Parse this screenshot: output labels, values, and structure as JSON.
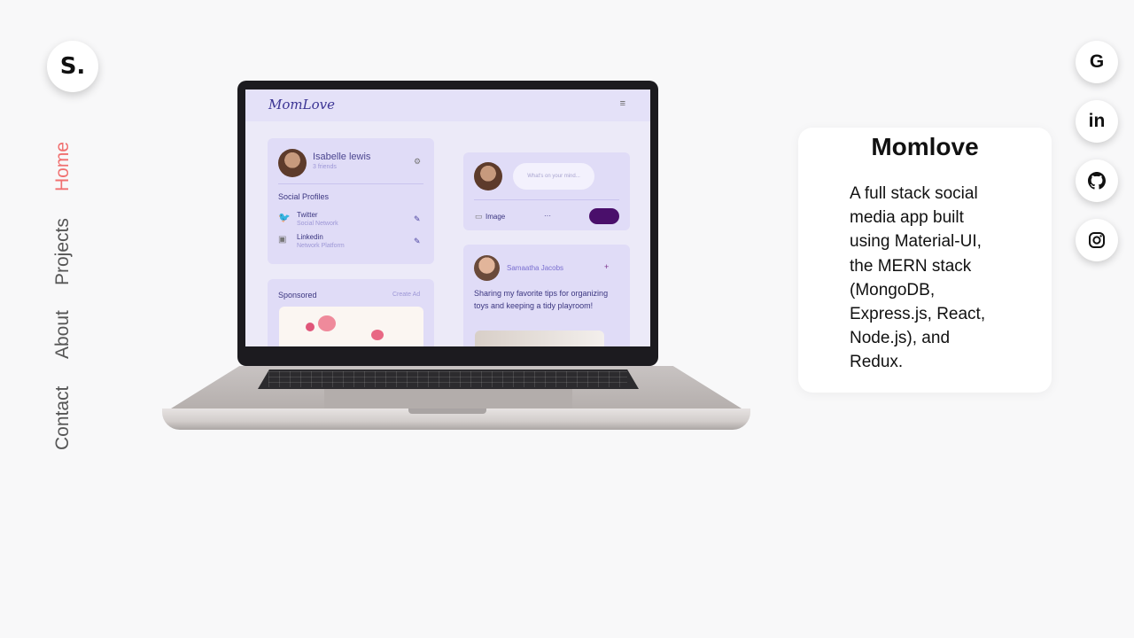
{
  "logo": {
    "text": "S."
  },
  "nav": {
    "items": [
      {
        "label": "Home",
        "active": true
      },
      {
        "label": "Projects",
        "active": false
      },
      {
        "label": "About",
        "active": false
      },
      {
        "label": "Contact",
        "active": false
      }
    ]
  },
  "laptop_screen": {
    "app_logo": "MomLove",
    "profile": {
      "name": "Isabelle lewis",
      "friends": "3 friends",
      "social_heading": "Social Profiles",
      "twitter": "Twitter",
      "twitter_sub": "Social Network",
      "linkedin": "Linkedin",
      "linkedin_sub": "Network Platform"
    },
    "composer": {
      "placeholder": "What's on your mind...",
      "image_label": "Image",
      "more": "···"
    },
    "sponsored": {
      "label": "Sponsored",
      "create_ad": "Create Ad"
    },
    "post": {
      "author": "Samaatha Jacobs",
      "text": "Sharing my favorite tips for organizing toys and keeping a tidy playroom!"
    }
  },
  "project": {
    "title": "Momlove",
    "description": "A full stack social media app built using Material-UI, the MERN stack (MongoDB, Express.js, React, Node.js), and Redux."
  },
  "social": [
    {
      "name": "google",
      "glyph": "G"
    },
    {
      "name": "linkedin",
      "glyph": "in"
    },
    {
      "name": "github",
      "glyph": ""
    },
    {
      "name": "instagram",
      "glyph": ""
    }
  ],
  "colors": {
    "accent": "#f07070",
    "background": "#f8f8f9",
    "card": "#ffffff"
  }
}
